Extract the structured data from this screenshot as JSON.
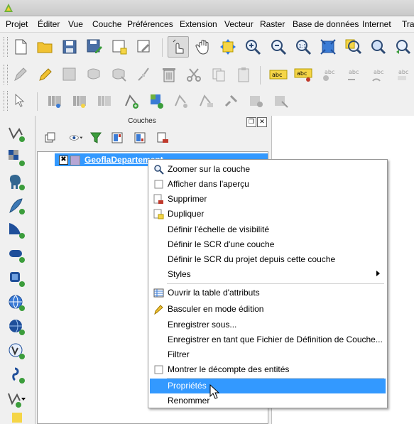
{
  "menubar": {
    "items": [
      "Projet",
      "Éditer",
      "Vue",
      "Couche",
      "Préférences",
      "Extension",
      "Vecteur",
      "Raster",
      "Base de données",
      "Internet",
      "Trai"
    ]
  },
  "layers_panel": {
    "title": "Couches",
    "layer": {
      "name": "GeoflaDepartement",
      "checked": "✖"
    }
  },
  "context_menu": {
    "items": [
      {
        "label": "Zoomer sur la couche",
        "icon": "zoom-icon"
      },
      {
        "label": "Afficher dans l'aperçu",
        "icon": "checkbox-icon"
      },
      {
        "label": "Supprimer",
        "icon": "remove-layer-icon"
      },
      {
        "label": "Dupliquer",
        "icon": "duplicate-layer-icon"
      },
      {
        "label": "Définir l'échelle de visibilité",
        "icon": ""
      },
      {
        "label": "Définir le SCR d'une couche",
        "icon": ""
      },
      {
        "label": "Définir le SCR du projet depuis cette couche",
        "icon": ""
      },
      {
        "label": "Styles",
        "icon": "submenu-arrow-icon"
      },
      {
        "label": "Ouvrir la table d'attributs",
        "icon": "table-icon"
      },
      {
        "label": "Basculer en mode édition",
        "icon": "pencil-icon"
      },
      {
        "label": "Enregistrer sous...",
        "icon": ""
      },
      {
        "label": "Enregistrer en tant que Fichier de Définition de Couche...",
        "icon": ""
      },
      {
        "label": "Filtrer",
        "icon": ""
      },
      {
        "label": "Montrer le décompte des entités",
        "icon": "checkbox-icon"
      },
      {
        "label": "Propriétés",
        "icon": "",
        "highlighted": true
      },
      {
        "label": "Renommer",
        "icon": ""
      }
    ]
  },
  "colors": {
    "selection": "#3399ff",
    "layer_swatch": "#b7a6d4"
  }
}
